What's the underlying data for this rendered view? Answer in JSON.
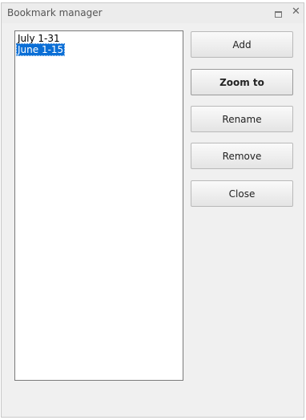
{
  "window": {
    "title": "Bookmark manager",
    "restore_icon": "restore-icon",
    "close_glyph": "✕"
  },
  "bookmarks": [
    {
      "label": "July 1-31",
      "selected": false
    },
    {
      "label": "June 1-15",
      "selected": true
    }
  ],
  "buttons": {
    "add": "Add",
    "zoom_to": "Zoom to",
    "rename": "Rename",
    "remove": "Remove",
    "close": "Close"
  },
  "colors": {
    "selection": "#0b6fd6",
    "panel_bg": "#f0f0f0"
  }
}
